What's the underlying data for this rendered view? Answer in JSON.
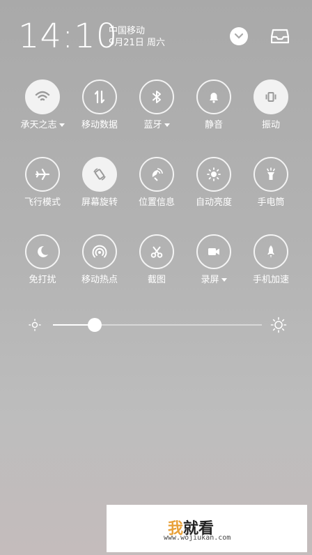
{
  "status": {
    "time": "14:10",
    "carrier": "中国移动",
    "date": "9月21日 周六"
  },
  "tiles": [
    {
      "label": "承天之志",
      "on": true,
      "caret": true,
      "icon": "wifi-icon"
    },
    {
      "label": "移动数据",
      "on": false,
      "caret": false,
      "icon": "mobile-data-icon"
    },
    {
      "label": "蓝牙",
      "on": false,
      "caret": true,
      "icon": "bluetooth-icon"
    },
    {
      "label": "静音",
      "on": false,
      "caret": false,
      "icon": "bell-icon"
    },
    {
      "label": "振动",
      "on": true,
      "caret": false,
      "icon": "vibrate-icon"
    },
    {
      "label": "飞行模式",
      "on": false,
      "caret": false,
      "icon": "airplane-icon"
    },
    {
      "label": "屏幕旋转",
      "on": true,
      "caret": false,
      "icon": "rotate-icon"
    },
    {
      "label": "位置信息",
      "on": false,
      "caret": false,
      "icon": "location-icon"
    },
    {
      "label": "自动亮度",
      "on": false,
      "caret": false,
      "icon": "auto-brightness-icon"
    },
    {
      "label": "手电筒",
      "on": false,
      "caret": false,
      "icon": "flashlight-icon"
    },
    {
      "label": "免打扰",
      "on": false,
      "caret": false,
      "icon": "moon-icon"
    },
    {
      "label": "移动热点",
      "on": false,
      "caret": false,
      "icon": "hotspot-icon"
    },
    {
      "label": "截图",
      "on": false,
      "caret": false,
      "icon": "scissors-icon"
    },
    {
      "label": "录屏",
      "on": false,
      "caret": true,
      "icon": "record-icon"
    },
    {
      "label": "手机加速",
      "on": false,
      "caret": false,
      "icon": "rocket-icon"
    }
  ],
  "brightness": {
    "level": 0.2
  },
  "watermark": {
    "brand_accent": "我",
    "brand_rest": "就看",
    "url": "www.wojiukan.com"
  },
  "colors": {
    "accent": "#e8a13a",
    "icon_on": "#9a9a9a"
  }
}
